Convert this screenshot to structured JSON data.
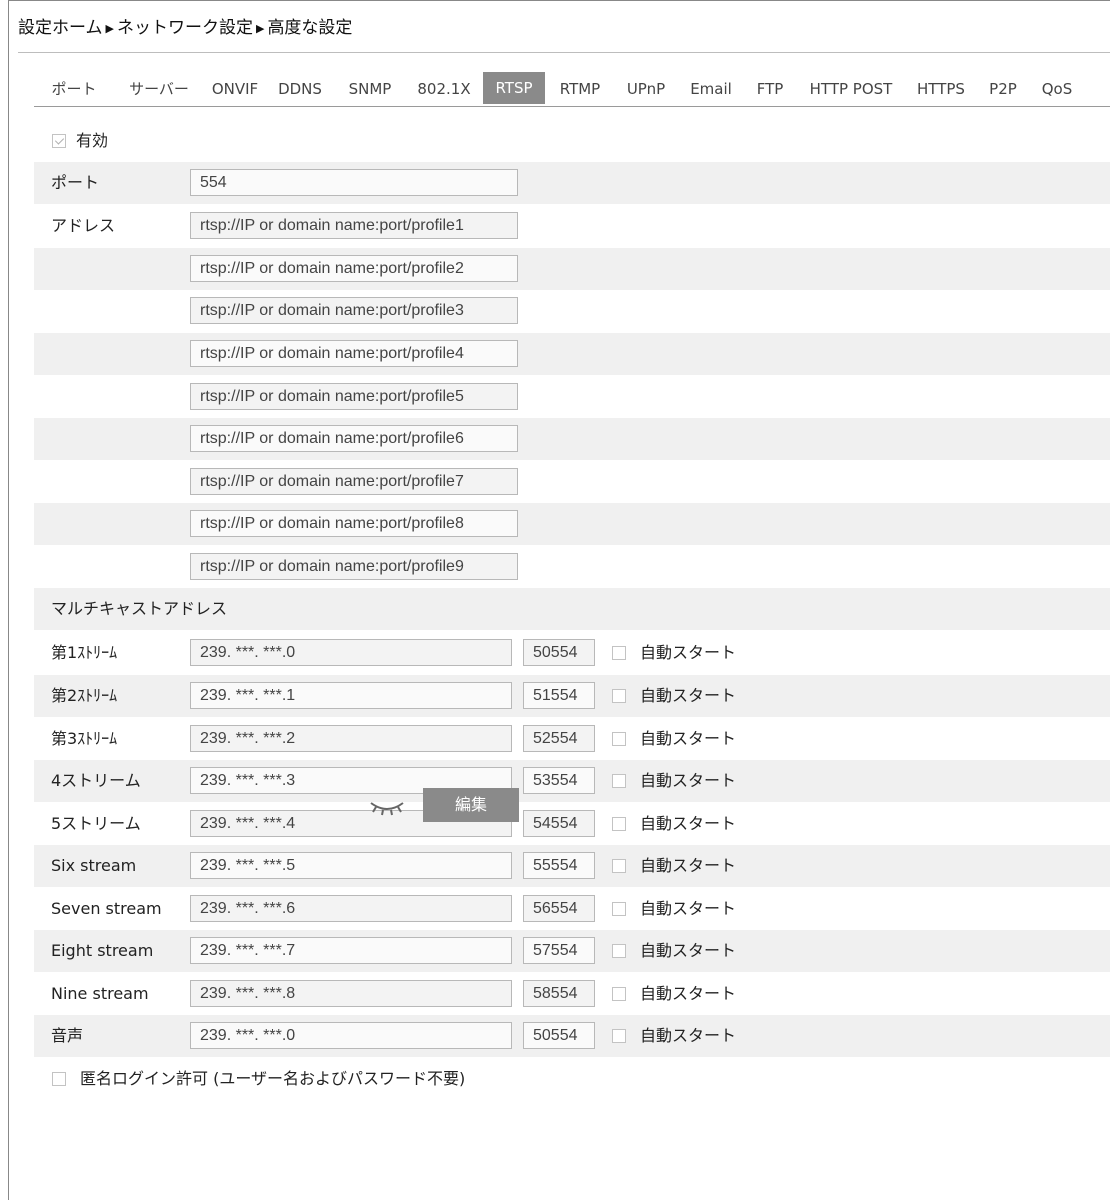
{
  "breadcrumb": [
    "設定ホーム",
    "ネットワーク設定",
    "高度な設定"
  ],
  "breadcrumb_sep": "▶",
  "tabs": [
    {
      "label": "ポート",
      "active": false
    },
    {
      "label": "サーバー",
      "active": false
    },
    {
      "label": "ONVIF",
      "active": false
    },
    {
      "label": "DDNS",
      "active": false
    },
    {
      "label": "SNMP",
      "active": false
    },
    {
      "label": "802.1X",
      "active": false
    },
    {
      "label": "RTSP",
      "active": true
    },
    {
      "label": "RTMP",
      "active": false
    },
    {
      "label": "UPnP",
      "active": false
    },
    {
      "label": "Email",
      "active": false
    },
    {
      "label": "FTP",
      "active": false
    },
    {
      "label": "HTTP POST",
      "active": false
    },
    {
      "label": "HTTPS",
      "active": false
    },
    {
      "label": "P2P",
      "active": false
    },
    {
      "label": "QoS",
      "active": false
    }
  ],
  "enable": {
    "label": "有効",
    "checked": true
  },
  "port": {
    "label": "ポート",
    "value": "554"
  },
  "address": {
    "label": "アドレス",
    "values": [
      "rtsp://IP or domain name:port/profile1",
      "rtsp://IP or domain name:port/profile2",
      "rtsp://IP or domain name:port/profile3",
      "rtsp://IP or domain name:port/profile4",
      "rtsp://IP or domain name:port/profile5",
      "rtsp://IP or domain name:port/profile6",
      "rtsp://IP or domain name:port/profile7",
      "rtsp://IP or domain name:port/profile8",
      "rtsp://IP or domain name:port/profile9"
    ]
  },
  "multicast": {
    "title": "マルチキャストアドレス",
    "auto_label": "自動スタート",
    "streams": [
      {
        "label": "第1ｽﾄﾘｰﾑ",
        "ip": "239. ***. ***.0",
        "port": "50554",
        "auto": false
      },
      {
        "label": "第2ｽﾄﾘｰﾑ",
        "ip": "239. ***. ***.1",
        "port": "51554",
        "auto": false
      },
      {
        "label": "第3ｽﾄﾘｰﾑ",
        "ip": "239. ***. ***.2",
        "port": "52554",
        "auto": false
      },
      {
        "label": "4ストリーム",
        "ip": "239. ***. ***.3",
        "port": "53554",
        "auto": false
      },
      {
        "label": "5ストリーム",
        "ip": "239. ***. ***.4",
        "port": "54554",
        "auto": false
      },
      {
        "label": "Six stream",
        "ip": "239. ***. ***.5",
        "port": "55554",
        "auto": false
      },
      {
        "label": "Seven stream",
        "ip": "239. ***. ***.6",
        "port": "56554",
        "auto": false
      },
      {
        "label": "Eight stream",
        "ip": "239. ***. ***.7",
        "port": "57554",
        "auto": false
      },
      {
        "label": "Nine stream",
        "ip": "239. ***. ***.8",
        "port": "58554",
        "auto": false
      },
      {
        "label": "音声",
        "ip": "239. ***. ***.0",
        "port": "50554",
        "auto": false
      }
    ]
  },
  "anonymous": {
    "label": "匿名ログイン許可 (ユーザー名およびパスワード不要)",
    "checked": false
  },
  "edit_button": "編集",
  "eye_icon": "eye-closed-icon"
}
